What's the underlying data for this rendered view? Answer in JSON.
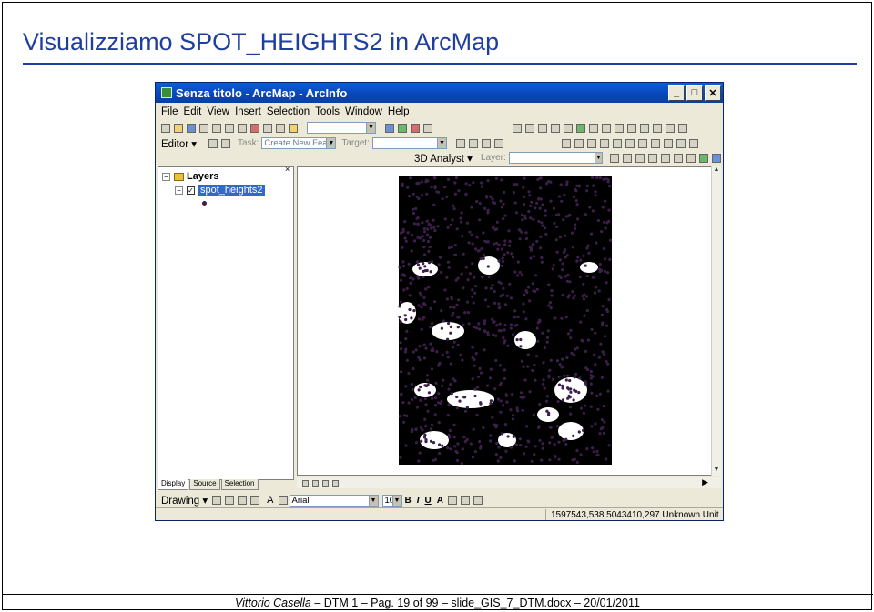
{
  "slide": {
    "title": "Visualizziamo SPOT_HEIGHTS2 in ArcMap",
    "footer_author": "Vittorio Casella",
    "footer_rest": " – DTM 1 – Pag. 19 of  99 – slide_GIS_7_DTM.docx – 20/01/2011"
  },
  "window": {
    "title": "Senza titolo - ArcMap - ArcInfo",
    "buttons": {
      "minimize": "_",
      "maximize": "□",
      "close": "✕"
    }
  },
  "menu": [
    "File",
    "Edit",
    "View",
    "Insert",
    "Selection",
    "Tools",
    "Window",
    "Help"
  ],
  "editor_toolbar": {
    "editor_label": "Editor ▾",
    "task_label": "Task:",
    "task_value": "Create New Fea",
    "target_label": "Target:"
  },
  "analyst_toolbar": {
    "analyst_label": "3D Analyst ▾",
    "layer_label": "Layer:"
  },
  "toc": {
    "root_label": "Layers",
    "layer_label": "spot_heights2",
    "tabs": [
      "Display",
      "Source",
      "Selection"
    ],
    "close": "×"
  },
  "drawing_toolbar": {
    "drawing_label": "Drawing ▾",
    "font_value": "Arial",
    "size_value": "10",
    "bold": "B",
    "italic": "I",
    "underline": "U",
    "text_color": "A"
  },
  "status": {
    "coordinates": "1597543,538  5043410,297 Unknown Unit"
  },
  "colors": {
    "title_blue": "#1f3f9f",
    "point_fill": "#3c1f4a",
    "titlebar_blue": "#0a5fd8",
    "window_bg": "#ece9d8"
  }
}
